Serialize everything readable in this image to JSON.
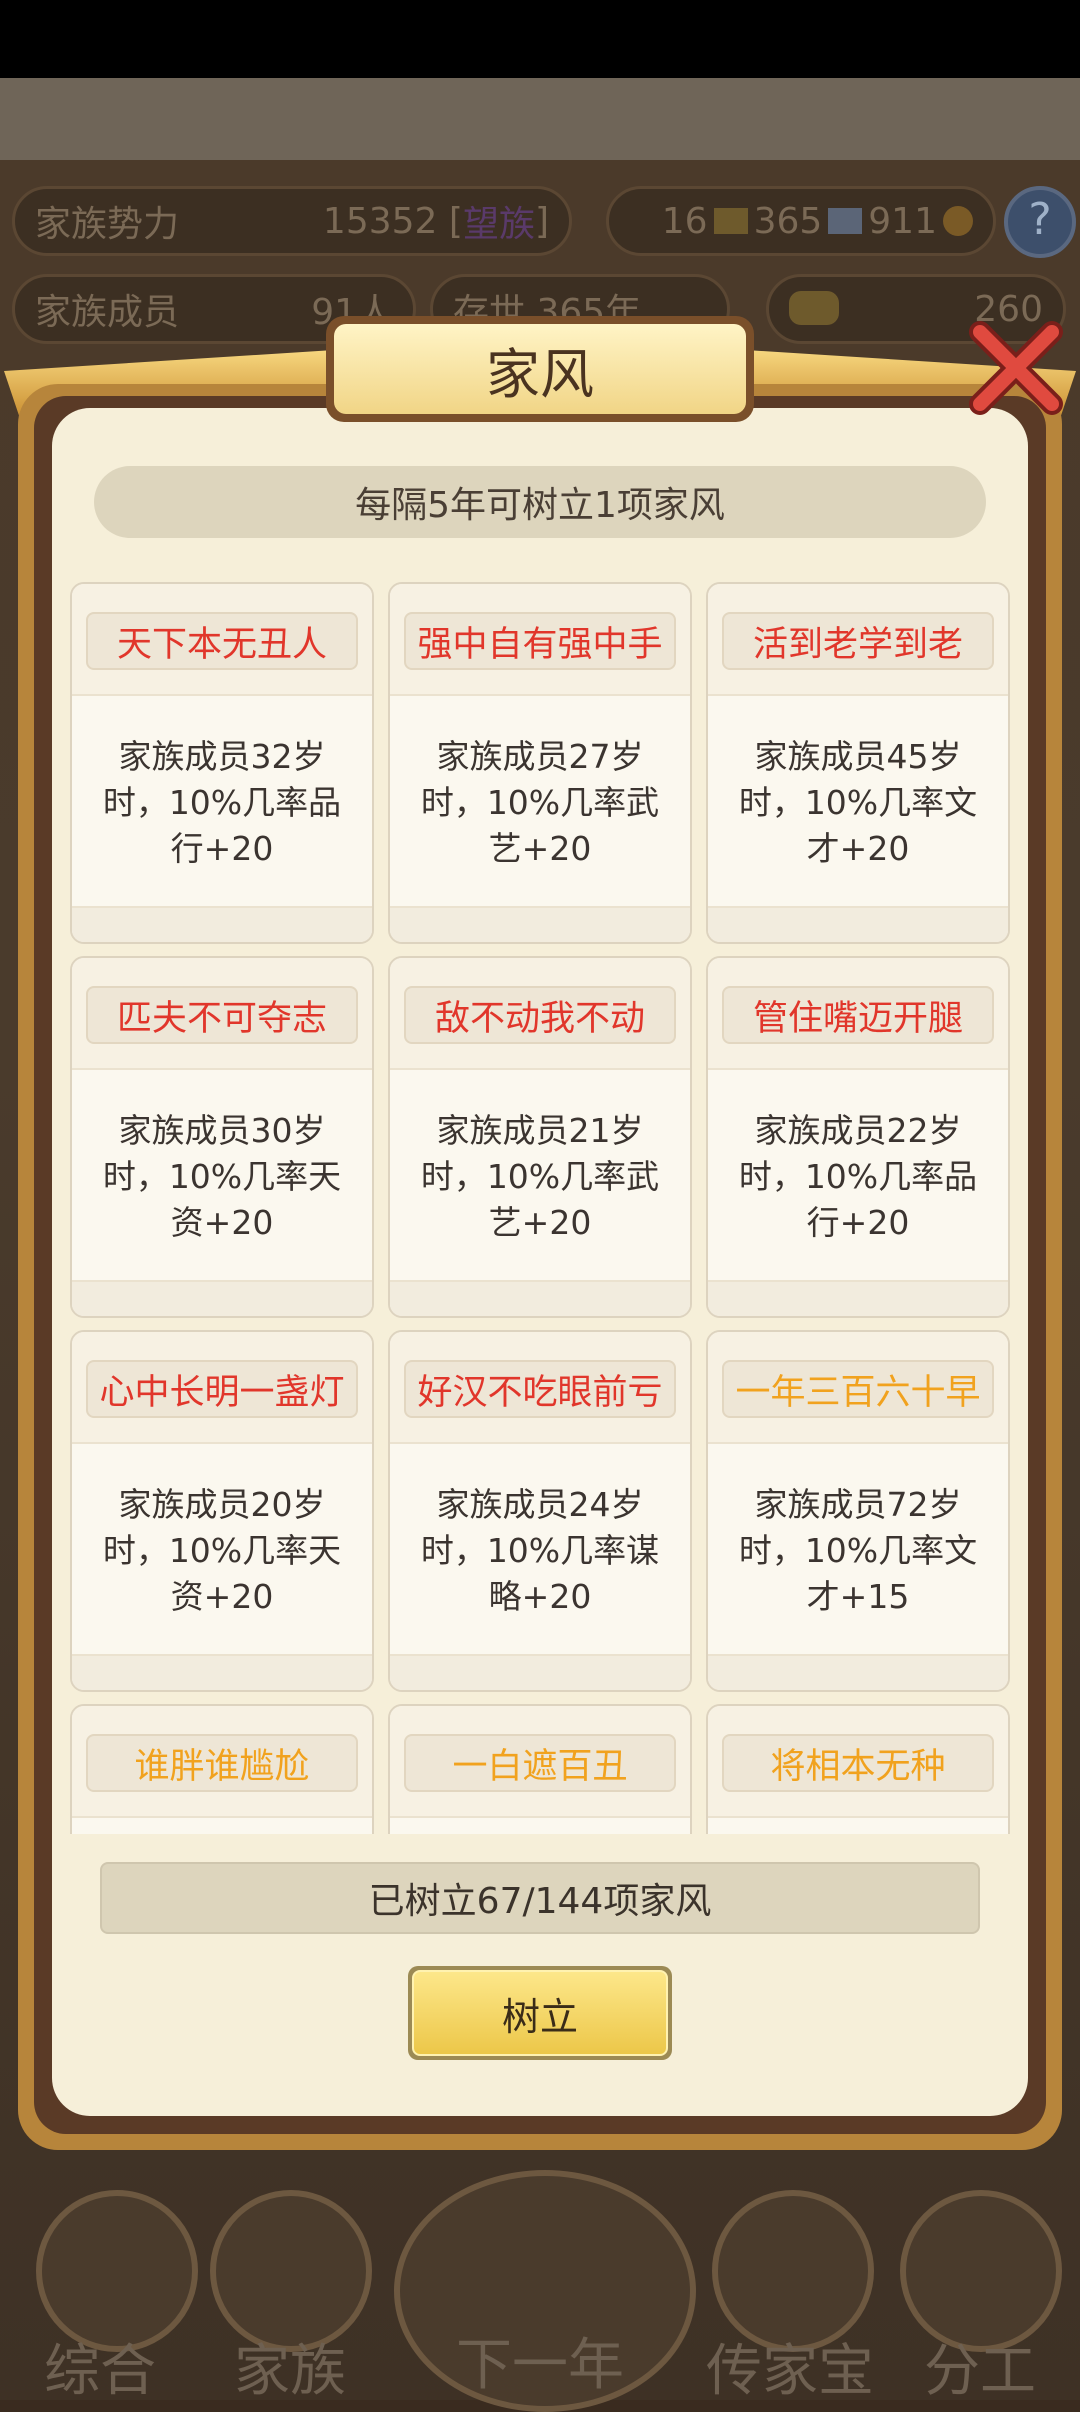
{
  "hud": {
    "power_label": "家族势力",
    "power_value": "15352 [",
    "power_rank": "望族",
    "power_close": "]",
    "res1": "16",
    "res2": "365",
    "res3": "911",
    "members_label": "家族成员",
    "members_value": "91人",
    "alive_label": "存世 365年",
    "gold_value": "260"
  },
  "modal": {
    "title": "家风",
    "info": "每隔5年可树立1项家风",
    "count": "已树立67/144项家风",
    "establish_button": "树立"
  },
  "cards": [
    {
      "name": "天下本无丑人",
      "desc": [
        "家族成员32岁",
        "时，10%几率品",
        "行+20"
      ],
      "color": "red"
    },
    {
      "name": "强中自有强中手",
      "desc": [
        "家族成员27岁",
        "时，10%几率武",
        "艺+20"
      ],
      "color": "red"
    },
    {
      "name": "活到老学到老",
      "desc": [
        "家族成员45岁",
        "时，10%几率文",
        "才+20"
      ],
      "color": "red"
    },
    {
      "name": "匹夫不可夺志",
      "desc": [
        "家族成员30岁",
        "时，10%几率天",
        "资+20"
      ],
      "color": "red"
    },
    {
      "name": "敌不动我不动",
      "desc": [
        "家族成员21岁",
        "时，10%几率武",
        "艺+20"
      ],
      "color": "red"
    },
    {
      "name": "管住嘴迈开腿",
      "desc": [
        "家族成员22岁",
        "时，10%几率品",
        "行+20"
      ],
      "color": "red"
    },
    {
      "name": "心中长明一盏灯",
      "desc": [
        "家族成员20岁",
        "时，10%几率天",
        "资+20"
      ],
      "color": "red"
    },
    {
      "name": "好汉不吃眼前亏",
      "desc": [
        "家族成员24岁",
        "时，10%几率谋",
        "略+20"
      ],
      "color": "red"
    },
    {
      "name": "一年三百六十早",
      "desc": [
        "家族成员72岁",
        "时，10%几率文",
        "才+15"
      ],
      "color": "orange"
    },
    {
      "name": "谁胖谁尴尬",
      "desc": [
        "",
        "",
        ""
      ],
      "color": "orange"
    },
    {
      "name": "一白遮百丑",
      "desc": [
        "",
        "",
        ""
      ],
      "color": "orange"
    },
    {
      "name": "将相本无种",
      "desc": [
        "",
        "",
        ""
      ],
      "color": "orange"
    }
  ],
  "nav": {
    "items": [
      "综合",
      "家族",
      "下一年",
      "传家宝",
      "分工"
    ]
  },
  "colors": {
    "panel_bg": "#f6efd9",
    "name_red": "#e1362b",
    "name_orange": "#f1a21e",
    "button_gold": "#ecc749"
  }
}
